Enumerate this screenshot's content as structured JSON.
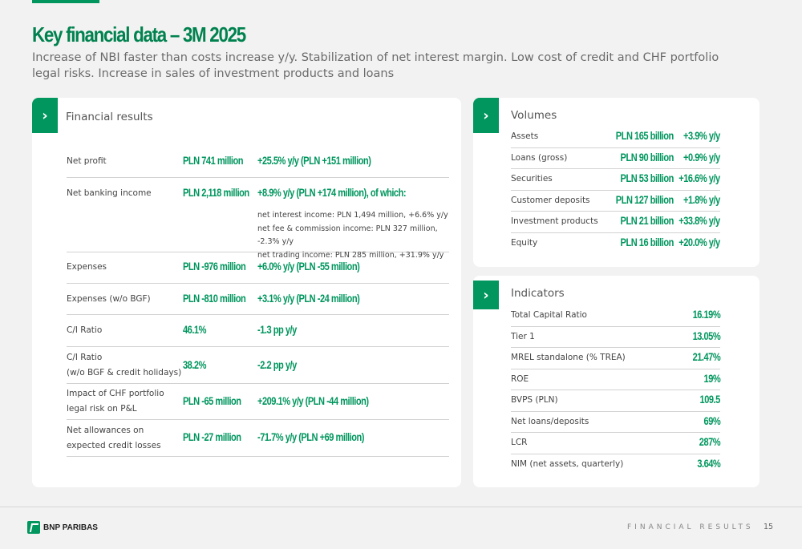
{
  "slide": {
    "title": "Key financial data – 3M 2025",
    "subtitle": "Increase of NBI faster than costs increase y/y. Stabilization of net interest margin. Low cost of credit and CHF portfolio legal risks. Increase in sales of investment products and loans"
  },
  "financial_results": {
    "title": "Financial results",
    "rows": [
      {
        "label": "Net profit",
        "value": "PLN 741 million",
        "change": "+25.5% y/y (PLN +151 million)"
      },
      {
        "label": "Net banking income",
        "value": "PLN 2,118 million",
        "change": "+8.9% y/y (PLN +174 million), of which:",
        "details": [
          "net interest income: PLN 1,494 million, +6.6% y/y",
          "net fee & commission income: PLN 327 million, -2.3% y/y",
          "net trading income: PLN 285 million, +31.9% y/y"
        ]
      },
      {
        "label": "Expenses",
        "value": "PLN -976 million",
        "change": "+6.0% y/y (PLN -55 million)"
      },
      {
        "label": "Expenses (w/o BGF)",
        "value": "PLN -810 million",
        "change": "+3.1% y/y (PLN -24 million)"
      },
      {
        "label": "C/I Ratio",
        "value": "46.1%",
        "change": "-1.3 pp y/y"
      },
      {
        "label": [
          "C/I Ratio",
          "(w/o BGF & credit holidays)"
        ],
        "value": "38.2%",
        "change": "-2.2 pp y/y"
      },
      {
        "label": [
          "Impact of CHF portfolio",
          "legal risk on P&L"
        ],
        "value": "PLN -65 million",
        "change": "+209.1% y/y (PLN -44 million)"
      },
      {
        "label": [
          "Net allowances on",
          "expected credit losses"
        ],
        "value": "PLN -27 million",
        "change": "-71.7% y/y (PLN +69 million)"
      }
    ]
  },
  "volumes": {
    "title": "Volumes",
    "rows": [
      {
        "label": "Assets",
        "value": "PLN 165 billion",
        "change": "+3.9% y/y"
      },
      {
        "label": "Loans (gross)",
        "value": "PLN 90 billion",
        "change": "+0.9% y/y"
      },
      {
        "label": "Securities",
        "value": "PLN 53 billion",
        "change": "+16.6% y/y"
      },
      {
        "label": "Customer deposits",
        "value": "PLN 127 billion",
        "change": "+1.8% y/y"
      },
      {
        "label": "Investment products",
        "value": "PLN 21 billion",
        "change": "+33.8% y/y"
      },
      {
        "label": "Equity",
        "value": "PLN 16 billion",
        "change": "+20.0% y/y"
      }
    ]
  },
  "indicators": {
    "title": "Indicators",
    "rows": [
      {
        "label": "Total Capital Ratio",
        "value": "16.19%"
      },
      {
        "label": "Tier 1",
        "value": "13.05%"
      },
      {
        "label": "MREL standalone (% TREA)",
        "value": "21.47%"
      },
      {
        "label": "ROE",
        "value": "19%"
      },
      {
        "label": "BVPS (PLN)",
        "value": "109.5"
      },
      {
        "label": "Net loans/deposits",
        "value": "69%"
      },
      {
        "label": "LCR",
        "value": "287%"
      },
      {
        "label": "NIM (net assets, quarterly)",
        "value": "3.64%"
      }
    ]
  },
  "footer": {
    "logo_text": "BNP PARIBAS",
    "section": "FINANCIAL RESULTS",
    "page": "15"
  },
  "icons": {
    "section_marker": "chevron-right-icon",
    "logo": "bnp-paribas-logo-icon"
  },
  "colors": {
    "accent": "#00965e",
    "title": "#00824f",
    "card": "#ffffff",
    "background": "#f2f2f2"
  }
}
